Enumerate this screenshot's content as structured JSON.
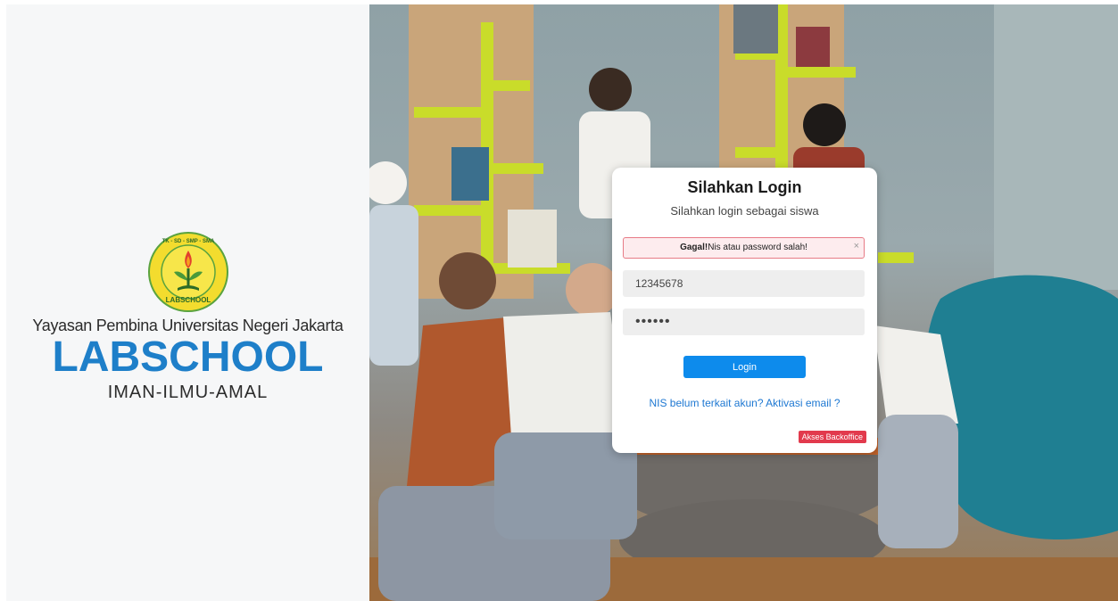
{
  "brand": {
    "foundation": "Yayasan Pembina Universitas Negeri Jakarta",
    "name": "LABSCHOOL",
    "motto": "IMAN-ILMU-AMAL",
    "logo_ring_text": "TK - SD - SMP - SMA",
    "logo_bottom_text": "LABSCHOOL",
    "colors": {
      "primary": "#1e7fc9",
      "logo_yellow": "#f3dc2e",
      "logo_green": "#4a9a3a"
    }
  },
  "login": {
    "title": "Silahkan Login",
    "subtitle": "Silahkan login sebagai siswa",
    "alert": {
      "strong": "Gagal!",
      "message": "Nis atau password salah!",
      "close": "×"
    },
    "nis_value": "12345678",
    "password_value": "••••••",
    "button_label": "Login",
    "activation_link": "NIS belum terkait akun? Aktivasi email ?",
    "backoffice_label": "Akses Backoffice",
    "colors": {
      "button": "#0d8bec",
      "link": "#1e78d2",
      "badge": "#e23a4d",
      "alert_border": "#e77b86"
    }
  }
}
